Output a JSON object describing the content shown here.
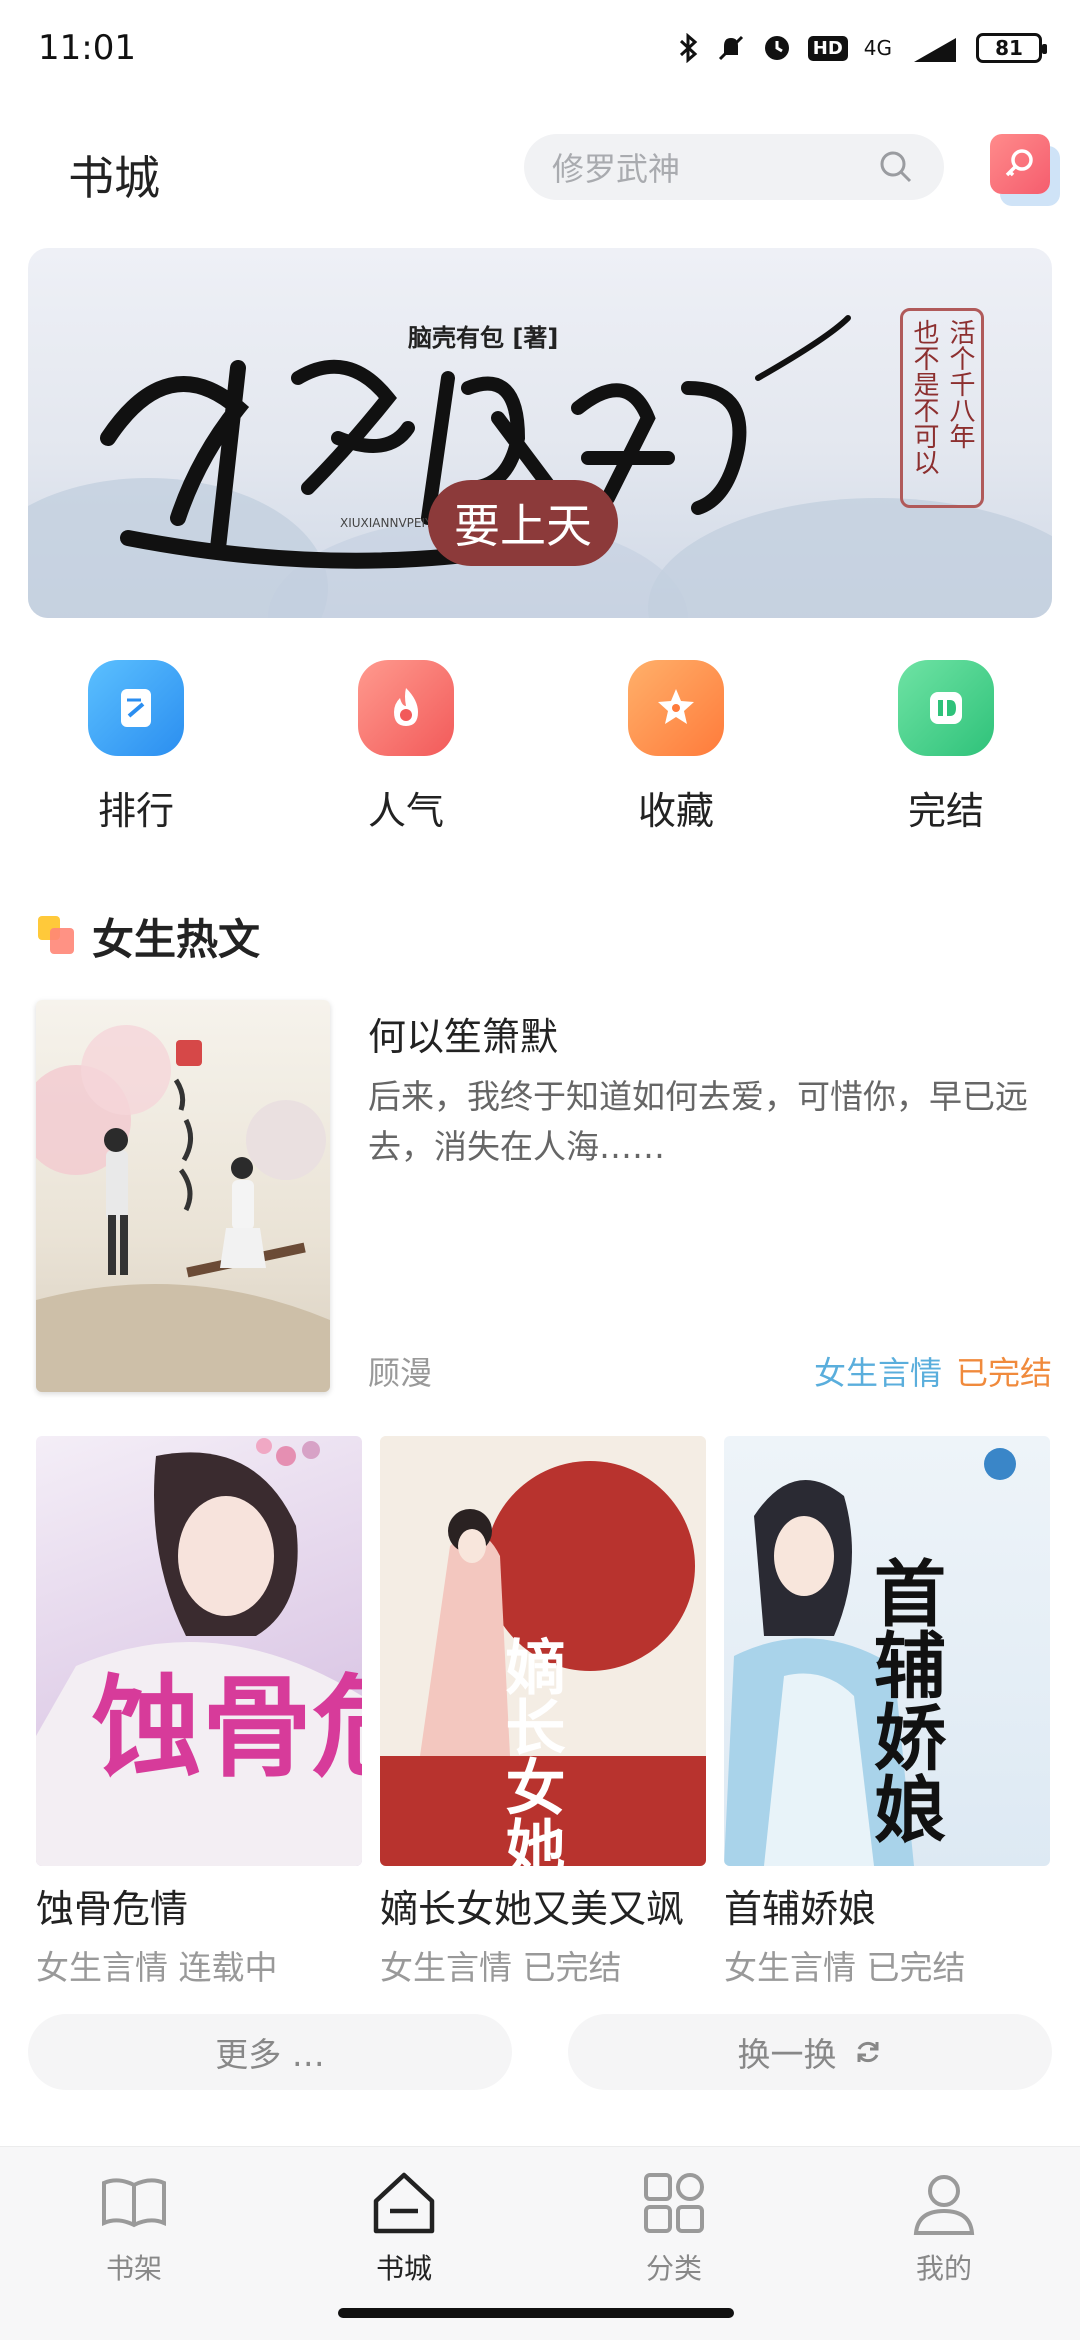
{
  "status": {
    "time": "11:01",
    "hd": "HD",
    "network": "4G",
    "battery": "81"
  },
  "header": {
    "title": "书城",
    "search_placeholder": "修罗武神"
  },
  "banner": {
    "author": "脑壳有包 [著]",
    "title": "修仙女配",
    "subtitle": "要上天",
    "pinyin": "XIUXIANNVPEIYAO SHANGTIAN",
    "slogan_col1": "活个千八年",
    "slogan_col2": "也不是不可以"
  },
  "quick_links": [
    {
      "label": "排行",
      "icon": "ranking-icon",
      "color": "#35a4f1"
    },
    {
      "label": "人气",
      "icon": "flame-icon",
      "color": "#f76b6b"
    },
    {
      "label": "收藏",
      "icon": "star-icon",
      "color": "#ff8a4a"
    },
    {
      "label": "完结",
      "icon": "finished-icon",
      "color": "#3dce86"
    }
  ],
  "section": {
    "title": "女生热文"
  },
  "featured": {
    "title": "何以笙箫默",
    "description": "后来，我终于知道如何去爱，可惜你，早已远去，消失在人海……",
    "author": "顾漫",
    "category": "女生言情",
    "status": "已完结"
  },
  "books": [
    {
      "title": "蚀骨危情",
      "category": "女生言情",
      "status": "连载中",
      "cover_text": "蚀骨危情"
    },
    {
      "title": "嫡长女她又美又飒",
      "category": "女生言情",
      "status": "已完结",
      "cover_text": "嫡长女她"
    },
    {
      "title": "首辅娇娘",
      "category": "女生言情",
      "status": "已完结",
      "cover_text": "首辅娇娘"
    }
  ],
  "actions": {
    "more": "更多 …",
    "refresh": "换一换"
  },
  "tabs": [
    {
      "label": "书架",
      "icon": "bookshelf-icon"
    },
    {
      "label": "书城",
      "icon": "store-icon"
    },
    {
      "label": "分类",
      "icon": "category-icon"
    },
    {
      "label": "我的",
      "icon": "profile-icon"
    }
  ],
  "colors": {
    "accent_blue": "#5aaedc",
    "accent_orange": "#f08a3c"
  }
}
